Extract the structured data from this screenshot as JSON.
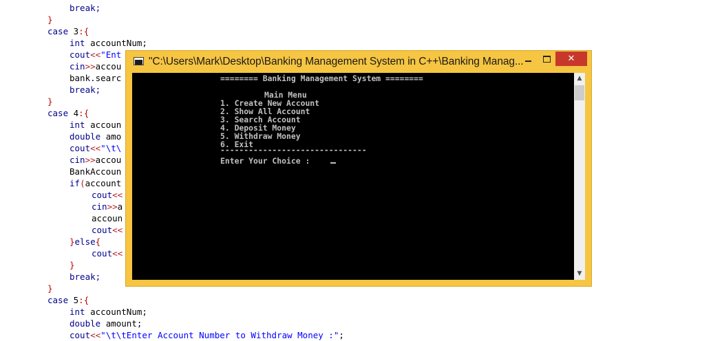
{
  "editor": {
    "lines": [
      {
        "indent": 3,
        "tokens": [
          {
            "t": "break;",
            "c": "kw"
          }
        ]
      },
      {
        "indent": 2,
        "tokens": [
          {
            "t": "}",
            "c": "brace"
          }
        ]
      },
      {
        "indent": 2,
        "tokens": [
          {
            "t": "case ",
            "c": "kw"
          },
          {
            "t": "3",
            "c": "plain"
          },
          {
            "t": ":{",
            "c": "brace"
          }
        ]
      },
      {
        "indent": 3,
        "tokens": [
          {
            "t": "int ",
            "c": "kw"
          },
          {
            "t": "accountNum;",
            "c": "plain"
          }
        ]
      },
      {
        "indent": 3,
        "tokens": [
          {
            "t": "cout",
            "c": "kw"
          },
          {
            "t": "<<",
            "c": "op"
          },
          {
            "t": "\"Ent",
            "c": "str"
          }
        ]
      },
      {
        "indent": 3,
        "tokens": [
          {
            "t": "cin",
            "c": "kw"
          },
          {
            "t": ">>",
            "c": "op"
          },
          {
            "t": "accou",
            "c": "plain"
          }
        ]
      },
      {
        "indent": 3,
        "tokens": [
          {
            "t": "bank.searc",
            "c": "plain"
          }
        ]
      },
      {
        "indent": 3,
        "tokens": [
          {
            "t": "break;",
            "c": "kw"
          }
        ]
      },
      {
        "indent": 2,
        "tokens": [
          {
            "t": "}",
            "c": "brace"
          }
        ]
      },
      {
        "indent": 2,
        "tokens": [
          {
            "t": "case ",
            "c": "kw"
          },
          {
            "t": "4",
            "c": "plain"
          },
          {
            "t": ":{",
            "c": "brace"
          }
        ]
      },
      {
        "indent": 3,
        "tokens": [
          {
            "t": "int ",
            "c": "kw"
          },
          {
            "t": "accoun",
            "c": "plain"
          }
        ]
      },
      {
        "indent": 3,
        "tokens": [
          {
            "t": "double ",
            "c": "kw"
          },
          {
            "t": "amo",
            "c": "plain"
          }
        ]
      },
      {
        "indent": 3,
        "tokens": [
          {
            "t": "cout",
            "c": "kw"
          },
          {
            "t": "<<",
            "c": "op"
          },
          {
            "t": "\"\\t\\",
            "c": "str"
          }
        ]
      },
      {
        "indent": 3,
        "tokens": [
          {
            "t": "cin",
            "c": "kw"
          },
          {
            "t": ">>",
            "c": "op"
          },
          {
            "t": "accou",
            "c": "plain"
          }
        ]
      },
      {
        "indent": 3,
        "tokens": [
          {
            "t": "BankAccoun",
            "c": "plain"
          }
        ]
      },
      {
        "indent": 3,
        "tokens": [
          {
            "t": "if",
            "c": "kw"
          },
          {
            "t": "(",
            "c": "op"
          },
          {
            "t": "account",
            "c": "plain"
          }
        ]
      },
      {
        "indent": 4,
        "tokens": [
          {
            "t": "cout",
            "c": "kw"
          },
          {
            "t": "<<",
            "c": "op"
          }
        ]
      },
      {
        "indent": 4,
        "tokens": [
          {
            "t": "cin",
            "c": "kw"
          },
          {
            "t": ">>",
            "c": "op"
          },
          {
            "t": "a",
            "c": "plain"
          }
        ]
      },
      {
        "indent": 4,
        "tokens": [
          {
            "t": "accoun",
            "c": "plain"
          }
        ]
      },
      {
        "indent": 4,
        "tokens": [
          {
            "t": "cout",
            "c": "kw"
          },
          {
            "t": "<<",
            "c": "op"
          }
        ]
      },
      {
        "indent": 3,
        "tokens": [
          {
            "t": "}",
            "c": "brace"
          },
          {
            "t": "else",
            "c": "kw"
          },
          {
            "t": "{",
            "c": "brace"
          }
        ]
      },
      {
        "indent": 4,
        "tokens": [
          {
            "t": "cout",
            "c": "kw"
          },
          {
            "t": "<<",
            "c": "op"
          }
        ]
      },
      {
        "indent": 3,
        "tokens": [
          {
            "t": "}",
            "c": "brace"
          }
        ]
      },
      {
        "indent": 3,
        "tokens": [
          {
            "t": "break;",
            "c": "kw"
          }
        ]
      },
      {
        "indent": 2,
        "tokens": [
          {
            "t": "}",
            "c": "brace"
          }
        ]
      },
      {
        "indent": 2,
        "tokens": [
          {
            "t": "case ",
            "c": "kw"
          },
          {
            "t": "5",
            "c": "plain"
          },
          {
            "t": ":{",
            "c": "brace"
          }
        ]
      },
      {
        "indent": 3,
        "tokens": [
          {
            "t": "int ",
            "c": "kw"
          },
          {
            "t": "accountNum;",
            "c": "plain"
          }
        ]
      },
      {
        "indent": 3,
        "tokens": [
          {
            "t": "double ",
            "c": "kw"
          },
          {
            "t": "amount;",
            "c": "plain"
          }
        ]
      },
      {
        "indent": 3,
        "tokens": [
          {
            "t": "cout",
            "c": "kw"
          },
          {
            "t": "<<",
            "c": "op"
          },
          {
            "t": "\"\\t\\tEnter Account Number to Withdraw Money :\"",
            "c": "str"
          },
          {
            "t": ";",
            "c": "plain"
          }
        ]
      }
    ]
  },
  "window": {
    "title": "\"C:\\Users\\Mark\\Desktop\\Banking Management System in C++\\Banking Manag...",
    "close_glyph": "✕"
  },
  "console": {
    "header": "======== Banking Management System ========",
    "menu_title": "Main Menu",
    "options": [
      "1. Create New Account",
      "2. Show All Account",
      "3. Search Account",
      "4. Deposit Money",
      "5. Withdraw Money",
      "6. Exit"
    ],
    "separator": "-------------------------------",
    "prompt": "Enter Your Choice :"
  },
  "scrollbar": {
    "up_glyph": "▲",
    "down_glyph": "▼"
  },
  "colors": {
    "titlebar": "#f6c542",
    "close_button": "#c7382b",
    "console_bg": "#000000",
    "console_text": "#c0c0c0",
    "keyword": "#00008b",
    "string": "#0000ff",
    "operator": "#b22222"
  }
}
